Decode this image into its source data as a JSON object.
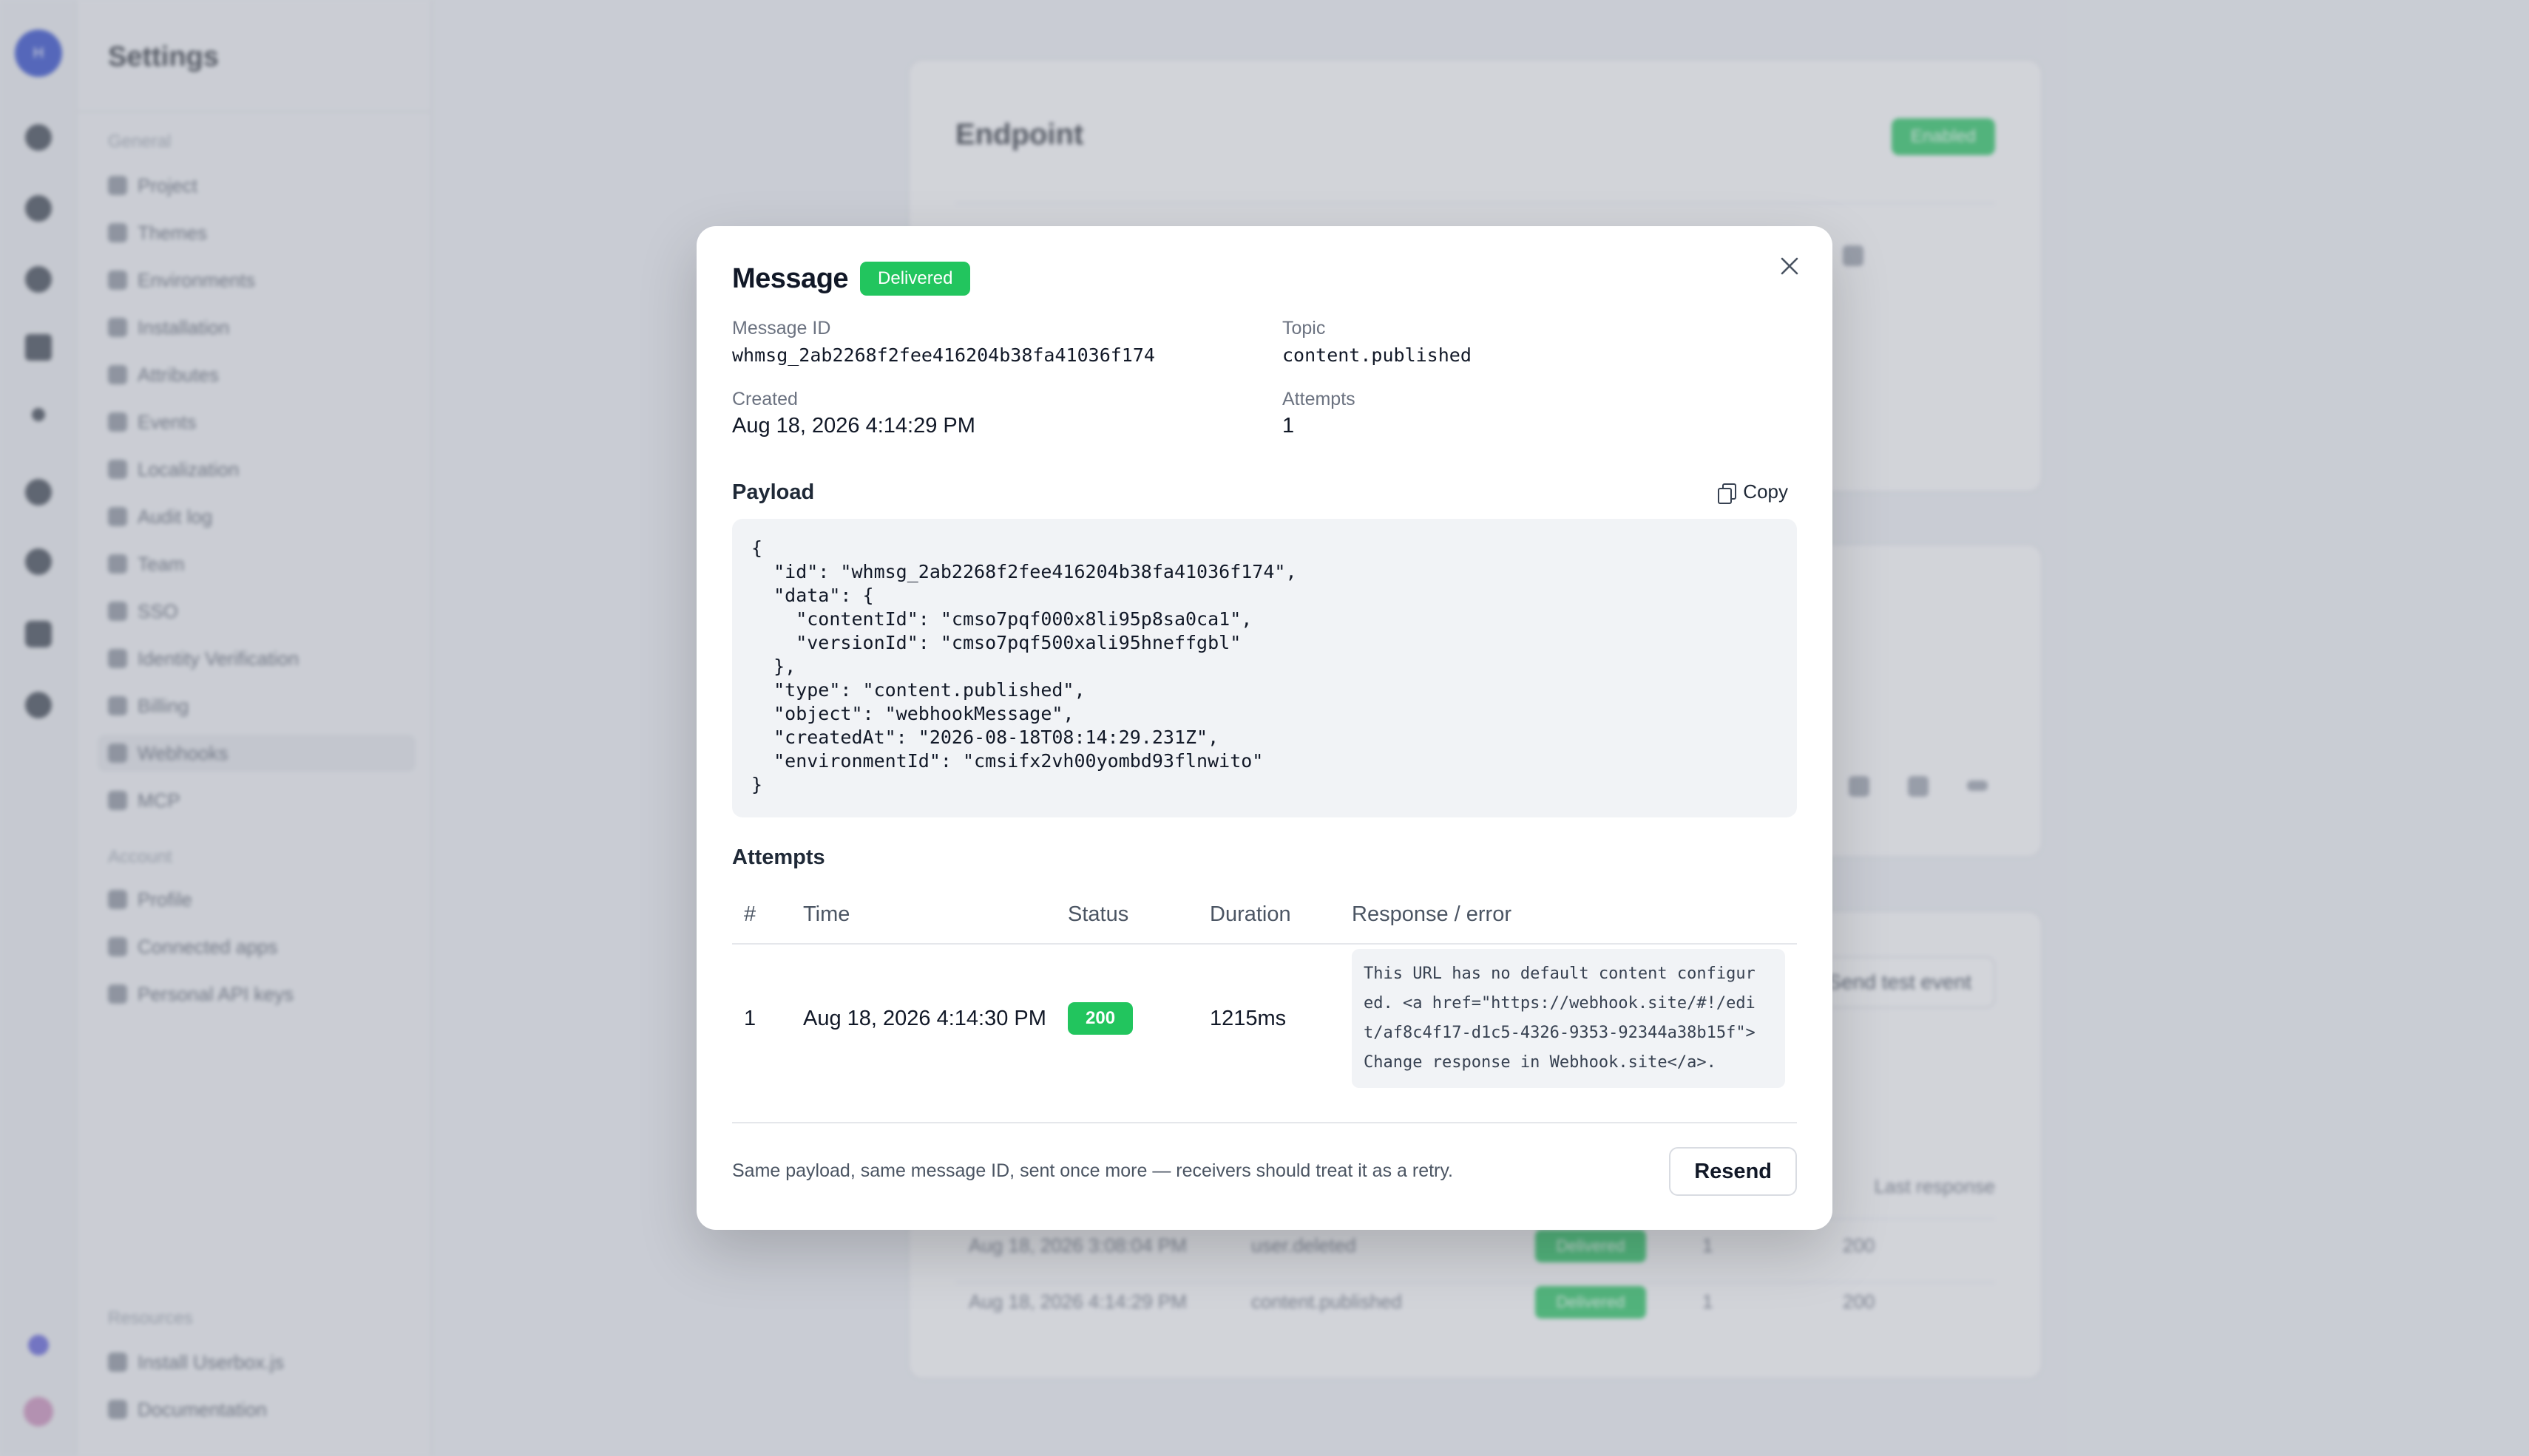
{
  "background": {
    "settings_title": "Settings",
    "rail_logo": "H",
    "general_heading": "General",
    "general_items": [
      "Project",
      "Themes",
      "Environments",
      "Installation",
      "Attributes",
      "Events",
      "Localization",
      "Audit log",
      "Team",
      "SSO",
      "Identity Verification",
      "Billing",
      "Webhooks",
      "MCP"
    ],
    "account_heading": "Account",
    "account_items": [
      "Profile",
      "Connected apps",
      "Personal API keys"
    ],
    "resources_heading": "Resources",
    "resources_items": [
      "Install Userbox.js",
      "Documentation"
    ],
    "endpoint_title": "Endpoint",
    "endpoint_badge": "Enabled",
    "send_test_event": "Send test event",
    "last_response": "Last response",
    "rows": [
      {
        "time": "Aug 18, 2026 3:08:04 PM",
        "topic": "user.deleted",
        "status": "Delivered",
        "attempts": "1",
        "code": "200"
      },
      {
        "time": "Aug 18, 2026 4:14:29 PM",
        "topic": "content.published",
        "status": "Delivered",
        "attempts": "1",
        "code": "200"
      }
    ]
  },
  "modal": {
    "title": "Message",
    "status_badge": "Delivered",
    "message_id_label": "Message ID",
    "message_id": "whmsg_2ab2268f2fee416204b38fa41036f174",
    "topic_label": "Topic",
    "topic": "content.published",
    "created_label": "Created",
    "created": "Aug 18, 2026 4:14:29 PM",
    "attempts_label": "Attempts",
    "attempts_count": "1",
    "payload_label": "Payload",
    "copy_label": "Copy",
    "payload": "{\n  \"id\": \"whmsg_2ab2268f2fee416204b38fa41036f174\",\n  \"data\": {\n    \"contentId\": \"cmso7pqf000x8li95p8sa0ca1\",\n    \"versionId\": \"cmso7pqf500xali95hneffgbl\"\n  },\n  \"type\": \"content.published\",\n  \"object\": \"webhookMessage\",\n  \"createdAt\": \"2026-08-18T08:14:29.231Z\",\n  \"environmentId\": \"cmsifx2vh00yombd93flnwito\"\n}",
    "attempts_section_label": "Attempts",
    "table": {
      "headers": [
        "#",
        "Time",
        "Status",
        "Duration",
        "Response / error"
      ],
      "rows": [
        {
          "num": "1",
          "time": "Aug 18, 2026 4:14:30 PM",
          "status": "200",
          "duration": "1215ms",
          "response": "This URL has no default content configur\ned. <a href=\"https://webhook.site/#!/edi\nt/af8c4f17-d1c5-4326-9353-92344a38b15f\">\nChange response in Webhook.site</a>."
        }
      ]
    },
    "footer_note": "Same payload, same message ID, sent once more — receivers should treat it as a retry.",
    "resend_label": "Resend"
  },
  "colors": {
    "accent_green": "#22c55e",
    "brand_blue": "#2743c9"
  }
}
